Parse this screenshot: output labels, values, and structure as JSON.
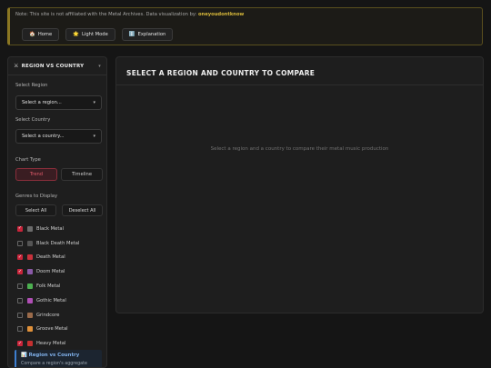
{
  "banner": {
    "note": "Note: This site is not affiliated with the Metal Archives. Data visualization by: ",
    "author": "oneyoudontknow",
    "nav": [
      {
        "icon": "🏠",
        "label": "Home"
      },
      {
        "icon": "🌟",
        "label": "Light Mode"
      },
      {
        "icon": "ℹ️",
        "label": "Explanation"
      }
    ]
  },
  "sidebar": {
    "title": "REGION VS COUNTRY",
    "region_label": "Select Region",
    "region_value": "Select a region...",
    "country_label": "Select Country",
    "country_value": "Select a country...",
    "chart_type_label": "Chart Type",
    "chart_types": [
      "Trend",
      "Timeline"
    ],
    "genres_label": "Genres to Display",
    "select_all": "Select All",
    "deselect_all": "Deselect All",
    "genres": [
      {
        "name": "Black Metal",
        "checked": true,
        "color": "#6b6b6b"
      },
      {
        "name": "Black Death Metal",
        "checked": false,
        "color": "#545454"
      },
      {
        "name": "Death Metal",
        "checked": true,
        "color": "#c8323c"
      },
      {
        "name": "Doom Metal",
        "checked": true,
        "color": "#8a5aa8"
      },
      {
        "name": "Folk Metal",
        "checked": false,
        "color": "#4caf50"
      },
      {
        "name": "Gothic Metal",
        "checked": false,
        "color": "#b04fb5"
      },
      {
        "name": "Grindcore",
        "checked": false,
        "color": "#9a6a4a"
      },
      {
        "name": "Groove Metal",
        "checked": false,
        "color": "#e0913a"
      },
      {
        "name": "Heavy Metal",
        "checked": true,
        "color": "#c53030"
      }
    ],
    "info_title": "Region vs Country",
    "info_text": "Compare a region's aggregate"
  },
  "main": {
    "title": "SELECT A REGION AND COUNTRY TO COMPARE",
    "placeholder": "Select a region and a country to compare their metal music production"
  }
}
